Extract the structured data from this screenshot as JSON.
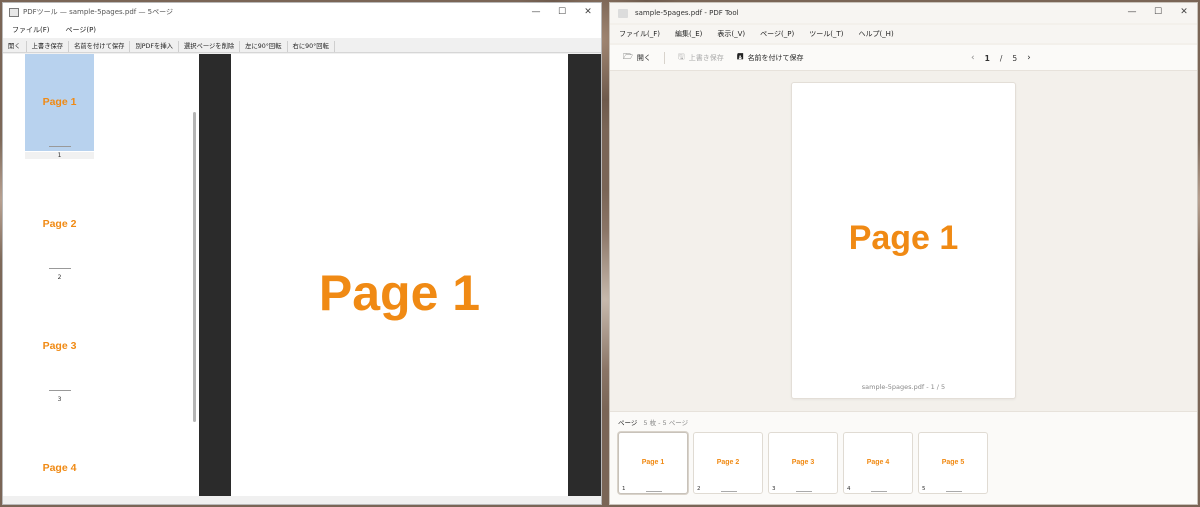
{
  "left_window": {
    "title": "PDFツール — sample-5pages.pdf — 5ページ",
    "controls": {
      "minimize": "—",
      "maximize": "☐",
      "close": "✕"
    },
    "menu": [
      "ファイル(F)",
      "ページ(P)"
    ],
    "toolbar": [
      "開く",
      "上書き保存",
      "名前を付けて保存",
      "別PDFを挿入",
      "選択ページを削除",
      "左に90°回転",
      "右に90°回転"
    ],
    "thumbnails": [
      {
        "label": "Page 1",
        "number": "1"
      },
      {
        "label": "Page 2",
        "number": "2"
      },
      {
        "label": "Page 3",
        "number": "3"
      },
      {
        "label": "Page 4",
        "number": "4"
      }
    ],
    "selected_thumbnail": 1,
    "viewer": {
      "page_text": "Page 1"
    }
  },
  "right_window": {
    "title": "sample-5pages.pdf - PDF Tool",
    "controls": {
      "minimize": "—",
      "maximize": "☐",
      "close": "✕"
    },
    "menu": [
      "ファイル(_F)",
      "編集(_E)",
      "表示(_V)",
      "ページ(_P)",
      "ツール(_T)",
      "ヘルプ(_H)"
    ],
    "toolbar": {
      "open": "開く",
      "save": "上書き保存",
      "save_as": "名前を付けて保存"
    },
    "pager": {
      "current": "1",
      "separator": "/",
      "total": "5"
    },
    "viewer": {
      "page_text": "Page 1",
      "caption": "sample-5pages.pdf - 1 / 5"
    },
    "strip": {
      "header": "ページ",
      "subheader": "5 枚 - 5 ページ",
      "pages": [
        {
          "label": "Page 1",
          "number": "1"
        },
        {
          "label": "Page 2",
          "number": "2"
        },
        {
          "label": "Page 3",
          "number": "3"
        },
        {
          "label": "Page 4",
          "number": "4"
        },
        {
          "label": "Page 5",
          "number": "5"
        }
      ]
    },
    "accent_color": "#f08a14"
  }
}
